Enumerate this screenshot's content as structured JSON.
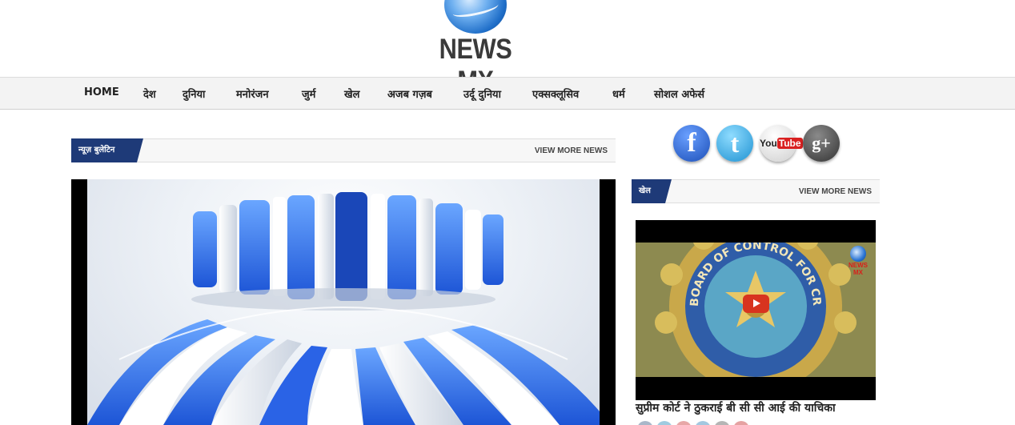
{
  "brand": {
    "name": "NEWS MX"
  },
  "nav": {
    "items": [
      "HOME",
      "देश",
      "दुनिया",
      "मनोरंजन",
      "जुर्म",
      "खेल",
      "अजब गज़ब",
      "उर्दू दुनिया",
      "एक्सक्लूसिव",
      "धर्म",
      "सोशल अफेर्स"
    ]
  },
  "main_section": {
    "title": "न्यूज़ बुलेटिन",
    "more_label": "VIEW MORE NEWS"
  },
  "side_section": {
    "title": "खेल",
    "more_label": "VIEW MORE NEWS",
    "video_caption": "सुप्रीम कोर्ट ने ठुकराई बी सी सी आई की याचिका",
    "video_watermark": "NEWS MX",
    "seal_text": "BOARD OF CONTROL FOR CRICKET IN INDIA"
  },
  "social": [
    {
      "icon": "facebook-icon",
      "glyph": "f",
      "color": "#2f6bd0"
    },
    {
      "icon": "twitter-icon",
      "glyph": "t",
      "color": "#2aa7e0"
    },
    {
      "icon": "youtube-icon",
      "glyph": "You",
      "color": "#e9e9e9"
    },
    {
      "icon": "google-plus-icon",
      "glyph": "g+",
      "color": "#555555"
    }
  ],
  "colors": {
    "accent": "#1e3a78",
    "nav_bg": "#f3f3f3",
    "text_dark": "#222222"
  }
}
